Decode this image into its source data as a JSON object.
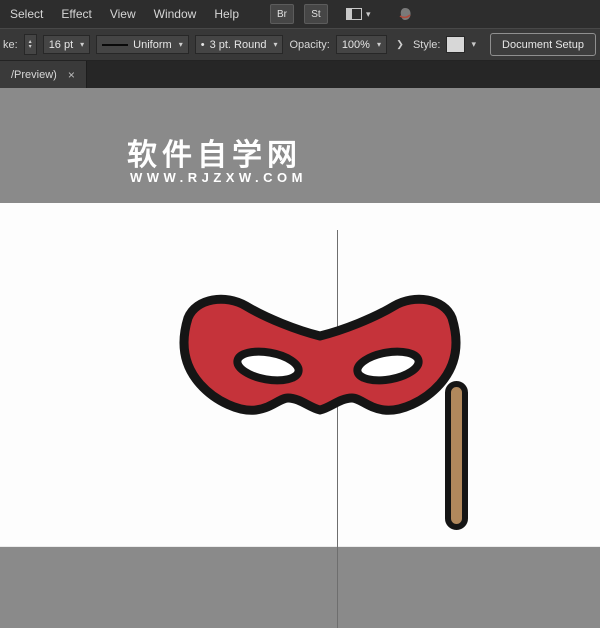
{
  "menubar": {
    "items": [
      "Select",
      "Effect",
      "View",
      "Window",
      "Help"
    ],
    "br_badge": "Br",
    "st_badge": "St"
  },
  "icons": {
    "chevron_down": "▾",
    "chevron_right": "❯",
    "stepper_up": "▴",
    "stepper_down": "▾",
    "brush_dot": "•"
  },
  "controlbar": {
    "stroke_label": "ke:",
    "stroke_width": "16 pt",
    "width_profile": "Uniform",
    "brush_definition": "3 pt. Round",
    "opacity_label": "Opacity:",
    "opacity_value": "100%",
    "style_label": "Style:",
    "document_setup": "Document Setup"
  },
  "tabbar": {
    "tab_title": "/Preview)",
    "close": "×"
  },
  "watermark": {
    "site_name": "软件自学网",
    "site_url": "WWW.RJZXW.COM"
  },
  "artwork": {
    "mask_fill": "#c5333a",
    "mask_stroke": "#151515",
    "eye_fill": "#ffffff",
    "stick_fill": "#b1885c"
  }
}
